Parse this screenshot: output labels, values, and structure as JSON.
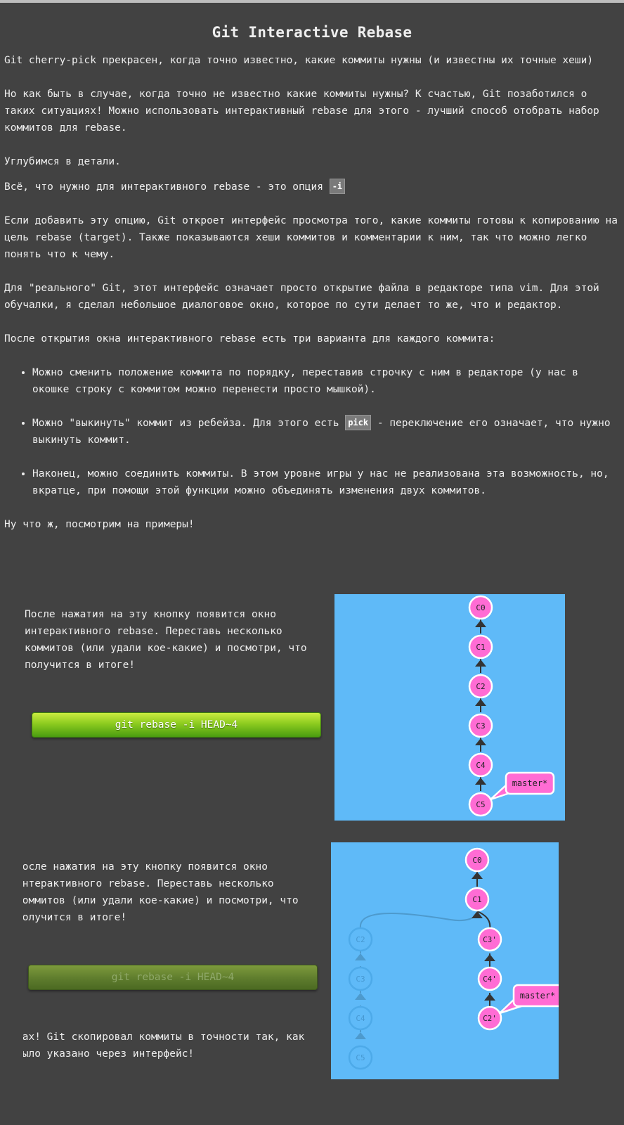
{
  "title": "Git Interactive Rebase",
  "paragraphs": {
    "p1": "Git cherry-pick прекрасен, когда точно известно, какие коммиты нужны (и известны их точные хеши)",
    "p2": "Но как быть в случае, когда точно не известно какие коммиты нужны? К счастью, Git позаботился о таких ситуациях! Можно использовать интерактивный rebase для этого - лучший способ отобрать набор коммитов для rebase.",
    "p3": "Углубимся в детали.",
    "p4_before": "Всё, что нужно для интерактивного rebase - это опция ",
    "p4_code": "-i",
    "p5": "Если добавить эту опцию, Git откроет интерфейс просмотра того, какие коммиты готовы к копированию на цель rebase (target). Также показываются хеши коммитов и комментарии к ним, так что можно легко понять что к чему.",
    "p6": "Для \"реального\" Git, этот интерфейс означает просто открытие файла в редакторе типа vim. Для этой обучалки, я сделал небольшое диалоговое окно, которое по сути делает то же, что и редактор.",
    "p7": "После открытия окна интерактивного rebase есть три варианта для каждого коммита:",
    "p8": "Ну что ж, посмотрим на примеры!"
  },
  "bullets": {
    "b1": "Можно сменить положение коммита по порядку, переставив строчку с ним в редакторе (у нас в окошке строку с коммитом можно перенести просто мышкой).",
    "b2_before": "Можно \"выкинуть\" коммит из ребейза. Для этого есть ",
    "b2_code": "pick",
    "b2_after": " - переключение его означает, что нужно выкинуть коммит.",
    "b3": "Наконец, можно соединить коммиты. В этом уровне игры у нас не реализована эта возможность, но, вкратце, при помощи этой функции можно объединять изменения двух коммитов."
  },
  "demo1": {
    "text": "После нажатия на эту кнопку появится окно интерактивного rebase. Переставь несколько коммитов (или удали кое-какие) и посмотри, что получится в итоге!",
    "button": "git rebase -i HEAD~4",
    "commits": [
      "C0",
      "C1",
      "C2",
      "C3",
      "C4",
      "C5"
    ],
    "branch": "master*",
    "colors": {
      "bg": "#5fbaf8",
      "commit": "#ff6cd4",
      "branch": "#ff6cd4"
    }
  },
  "demo2": {
    "text": "После нажатия на эту кнопку появится окно интерактивного rebase. Переставь несколько коммитов (или удали кое-какие) и посмотри, что получится в итоге!",
    "button": "git rebase -i HEAD~4",
    "after_text": "Вах! Git скопировал коммиты в точности так, как было указано через интерфейс!",
    "main_commits": [
      "C0",
      "C1",
      "C3'",
      "C4'",
      "C2'"
    ],
    "ghost_commits": [
      "C2",
      "C3",
      "C4",
      "C5"
    ],
    "branch": "master*"
  }
}
